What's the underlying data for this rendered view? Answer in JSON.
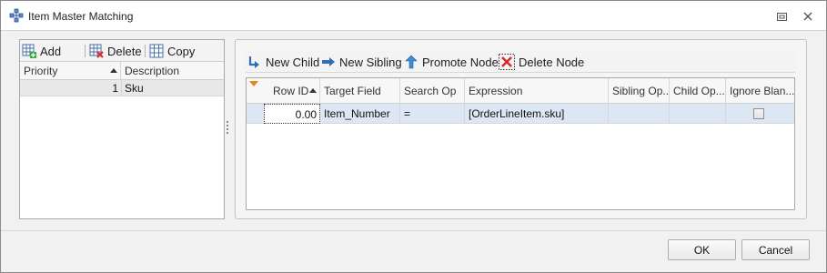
{
  "window": {
    "title": "Item Master Matching"
  },
  "left_toolbar": {
    "add_label": "Add",
    "delete_label": "Delete",
    "copy_label": "Copy"
  },
  "left_grid": {
    "columns": [
      "Priority",
      "Description"
    ],
    "rows": [
      {
        "priority": "1",
        "description": "Sku"
      }
    ]
  },
  "right_toolbar": {
    "new_child_label": "New Child",
    "new_sibling_label": "New Sibling",
    "promote_node_label": "Promote Node",
    "delete_node_label": "Delete Node"
  },
  "right_grid": {
    "columns": [
      "Row ID",
      "Target Field",
      "Search Op",
      "Expression",
      "Sibling Op...",
      "Child Op...",
      "Ignore Blan..."
    ],
    "rows": [
      {
        "row_id": "0.00",
        "target_field": "Item_Number",
        "search_op": "=",
        "expression": "[OrderLineItem.sku]",
        "sibling_op": "",
        "child_op": "",
        "ignore_blank": false
      }
    ]
  },
  "footer": {
    "ok_label": "OK",
    "cancel_label": "Cancel"
  }
}
